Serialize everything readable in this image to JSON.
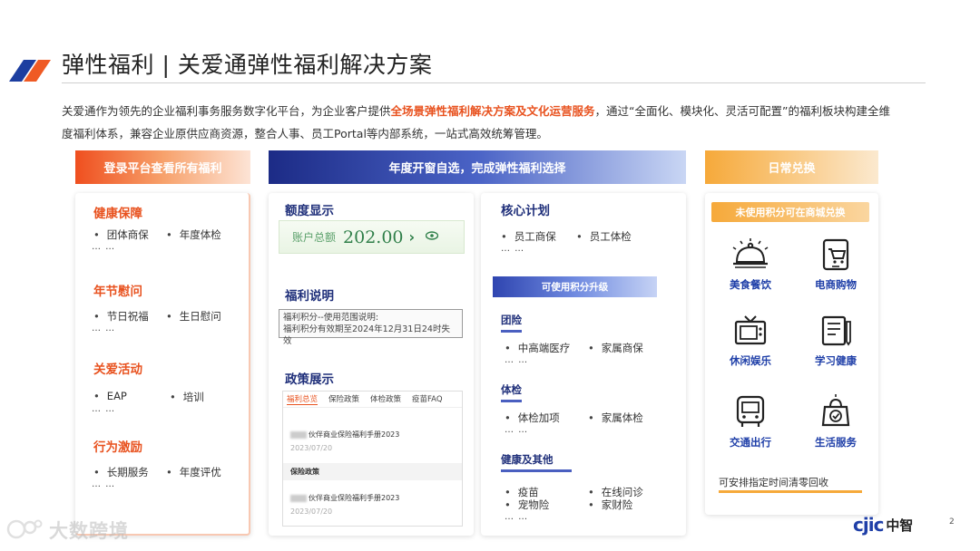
{
  "header": {
    "title": "弹性福利 | 关爱通弹性福利解决方案",
    "intro_before": "关爱通作为领先的企业福利事务服务数字化平台，为企业客户提供",
    "intro_highlight": "全场景弹性福利解决方案及文化运营服务",
    "intro_after": "，通过“全面化、模块化、灵活可配置”的福利板块构建全维度福利体系，兼容企业原供应商资源，整合人事、员工Portal等内部系统，一站式高效统筹管理。"
  },
  "columns": {
    "col1_header": "登录平台查看所有福利",
    "col2_header": "年度开窗自选，完成弹性福利选择",
    "col3_header": "日常兑换"
  },
  "benefits": {
    "sections": [
      {
        "title": "健康保障",
        "items": [
          "团体商保",
          "年度体检"
        ],
        "more": "… …"
      },
      {
        "title": "年节慰问",
        "items": [
          "节日祝福",
          "生日慰问"
        ],
        "more": "… …"
      },
      {
        "title": "关爱活动",
        "items": [
          "EAP",
          "培训"
        ],
        "more": "… …"
      },
      {
        "title": "行为激励",
        "items": [
          "长期服务",
          "年度评优"
        ],
        "more": "… …"
      }
    ]
  },
  "quota": {
    "title": "额度显示",
    "balance_label": "账户总额",
    "balance_value": "202.00",
    "chevron": "›",
    "notes_title": "福利说明",
    "notice_line1": "福利积分--使用范围说明:",
    "notice_line2": "福利积分有效期至2024年12月31日24时失效",
    "policy_title": "政策展示",
    "policy_tabs": [
      "福利总览",
      "保险政策",
      "体检政策",
      "疫苗FAQ"
    ],
    "policy_item1_title": "伙伴商业保险福利手册2023",
    "policy_item1_date": "2023/07/20",
    "policy_group": "保险政策",
    "policy_item2_title": "伙伴商业保险福利手册2023",
    "policy_item2_date": "2023/07/20"
  },
  "core": {
    "title": "核心计划",
    "items": [
      "员工商保",
      "员工体检"
    ],
    "more": "… …",
    "upgrade_label": "可使用积分升级",
    "groups": [
      {
        "title": "团险",
        "items": [
          "中高端医疗",
          "家属商保"
        ],
        "more": "… …"
      },
      {
        "title": "体检",
        "items": [
          "体检加项",
          "家属体检"
        ],
        "more": "… …"
      },
      {
        "title": "健康及其他",
        "items": [
          "疫苗",
          "在线问诊",
          "宠物险",
          "家财险"
        ],
        "more": "… …"
      }
    ]
  },
  "exchange": {
    "pill": "未使用积分可在商城兑换",
    "items": [
      {
        "label": "美食餐饮",
        "icon": "food-cloche-icon"
      },
      {
        "label": "电商购物",
        "icon": "shopping-cart-icon"
      },
      {
        "label": "休闲娱乐",
        "icon": "tv-icon"
      },
      {
        "label": "学习健康",
        "icon": "study-icon"
      },
      {
        "label": "交通出行",
        "icon": "bus-icon"
      },
      {
        "label": "生活服务",
        "icon": "life-service-icon"
      }
    ],
    "note": "可安排指定时间清零回收"
  },
  "footer": {
    "watermark": "大数跨境",
    "brand_en": "cjic",
    "brand_cn": "中智",
    "page_number": "2"
  },
  "colors": {
    "accent_orange": "#e8521f",
    "navy": "#1f2f7a",
    "brand_blue": "#1f3fa8",
    "gold": "#f6a93a"
  }
}
